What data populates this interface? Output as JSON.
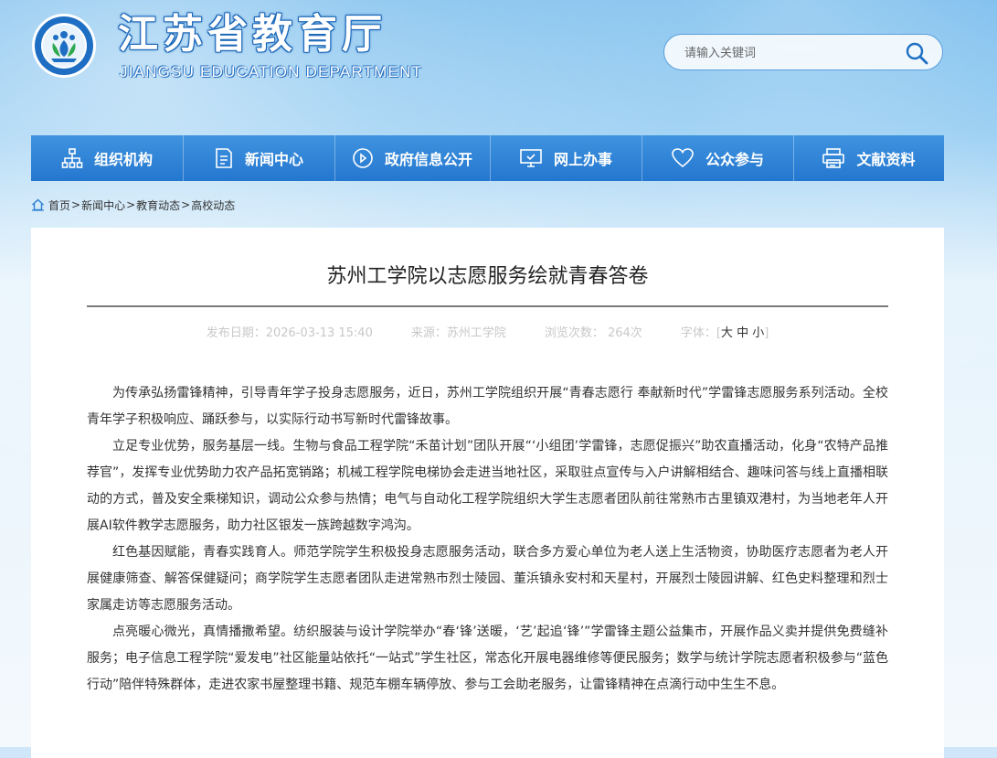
{
  "header": {
    "title": "江苏省教育厅",
    "subtitle": "JIANGSU EDUCATION DEPARTMENT",
    "search_placeholder": "请输入关键词"
  },
  "nav": {
    "items": [
      {
        "label": "组织机构",
        "icon": "org-chart-icon"
      },
      {
        "label": "新闻中心",
        "icon": "document-icon"
      },
      {
        "label": "政府信息公开",
        "icon": "play-circle-icon"
      },
      {
        "label": "网上办事",
        "icon": "monitor-icon"
      },
      {
        "label": "公众参与",
        "icon": "heart-icon"
      },
      {
        "label": "文献资料",
        "icon": "printer-icon"
      }
    ]
  },
  "breadcrumb": {
    "home": "首页",
    "items": [
      "新闻中心",
      "教育动态",
      "高校动态"
    ],
    "separator": ">"
  },
  "article": {
    "title": "苏州工学院以志愿服务绘就青春答卷",
    "meta": {
      "date": "发布日期：2026-03-13 15:40",
      "source": "来源：苏州工学院",
      "views": "浏览次数： 264次",
      "font_label": "字体：",
      "font_sizes": [
        "大",
        "中",
        "小"
      ]
    },
    "paragraphs": [
      "为传承弘扬雷锋精神，引导青年学子投身志愿服务，近日，苏州工学院组织开展“青春志愿行 奉献新时代”学雷锋志愿服务系列活动。全校青年学子积极响应、踊跃参与，以实际行动书写新时代雷锋故事。",
      "立足专业优势，服务基层一线。生物与食品工程学院“禾苗计划”团队开展“‘小组团’学雷锋，志愿促振兴”助农直播活动，化身“农特产品推荐官”，发挥专业优势助力农产品拓宽销路；机械工程学院电梯协会走进当地社区，采取驻点宣传与入户讲解相结合、趣味问答与线上直播相联动的方式，普及安全乘梯知识，调动公众参与热情；电气与自动化工程学院组织大学生志愿者团队前往常熟市古里镇双港村，为当地老年人开展AI软件教学志愿服务，助力社区银发一族跨越数字鸿沟。",
      "红色基因赋能，青春实践育人。师范学院学生积极投身志愿服务活动，联合多方爱心单位为老人送上生活物资，协助医疗志愿者为老人开展健康筛查、解答保健疑问；商学院学生志愿者团队走进常熟市烈士陵园、董浜镇永安村和天星村，开展烈士陵园讲解、红色史料整理和烈士家属走访等志愿服务活动。",
      "点亮暖心微光，真情播撒希望。纺织服装与设计学院举办“春‘锋’送暖，‘艺’起追‘锋’”学雷锋主题公益集市，开展作品义卖并提供免费缝补服务；电子信息工程学院“爱发电”社区能量站依托“一站式”学生社区，常态化开展电器维修等便民服务；数学与统计学院志愿者积极参与“蓝色行动”陪伴特殊群体，走进农家书屋整理书籍、规范车棚车辆停放、参与工会助老服务，让雷锋精神在点滴行动中生生不息。"
    ]
  },
  "colors": {
    "nav_bg": "#2a7dd4",
    "header_text_outline": "#1a66b8",
    "meta_text": "#c8c8c8"
  }
}
